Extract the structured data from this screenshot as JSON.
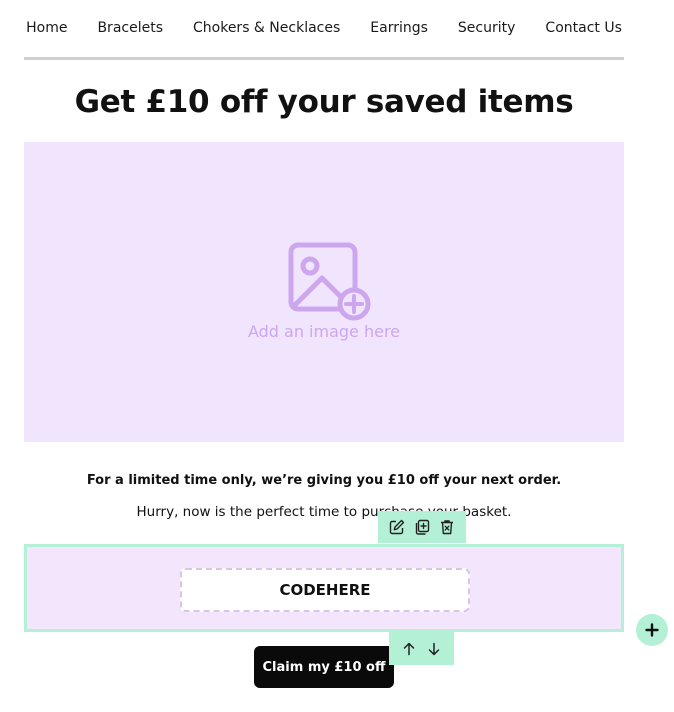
{
  "nav": {
    "items": [
      {
        "label": "Home"
      },
      {
        "label": "Bracelets"
      },
      {
        "label": "Chokers & Necklaces"
      },
      {
        "label": "Earrings"
      },
      {
        "label": "Security"
      },
      {
        "label": "Contact Us"
      }
    ]
  },
  "headline": "Get £10 off your saved items",
  "image_placeholder": {
    "label": "Add an image here",
    "icon": "image-add-icon"
  },
  "body": {
    "promo": "For a limited time only, we’re giving you £10 off your next order.",
    "subtext": "Hurry, now is the perfect time to purchase your basket."
  },
  "code_block": {
    "code": "CODEHERE"
  },
  "block_toolbar": {
    "icons": [
      "edit-icon",
      "duplicate-icon",
      "delete-icon"
    ]
  },
  "move_toolbar": {
    "icons": [
      "arrow-up-icon",
      "arrow-down-icon"
    ]
  },
  "add_block_icon": "plus-icon",
  "cta": {
    "label": "Claim my £10 off"
  },
  "colors": {
    "lavender_bg": "#f1e4fd",
    "placeholder_purple": "#cda7ee",
    "selection_green": "#b3f0d6",
    "cta_black": "#0a0a0a"
  }
}
